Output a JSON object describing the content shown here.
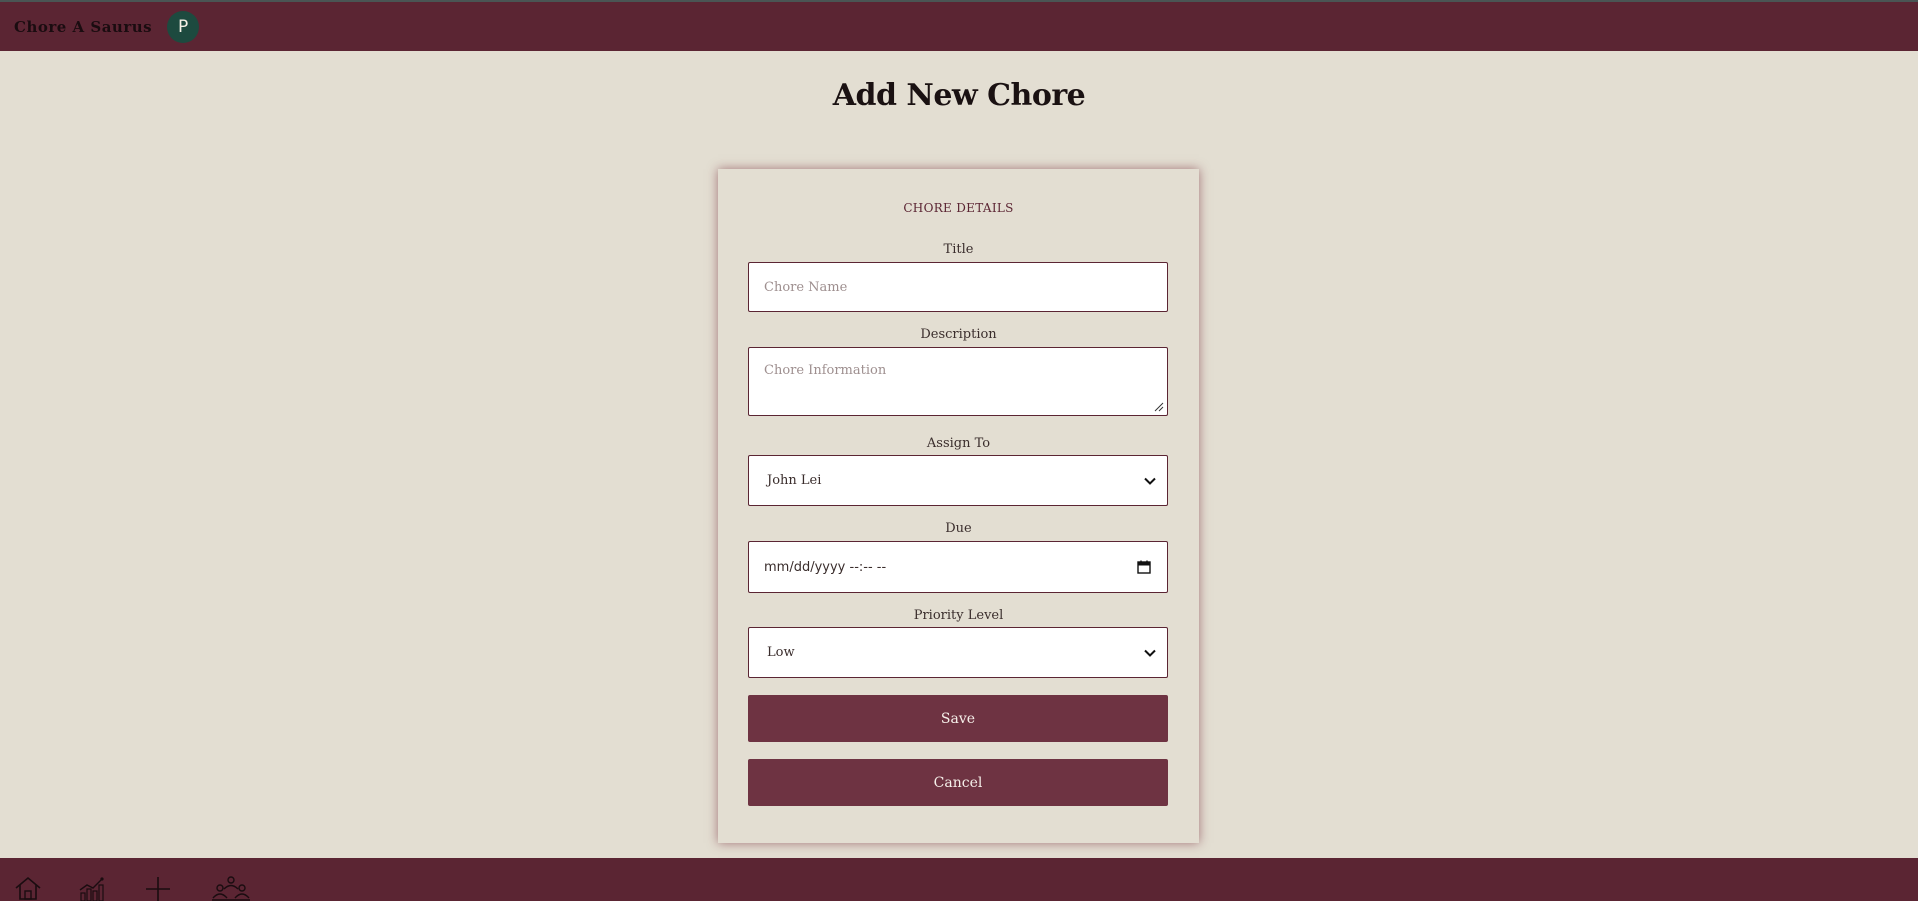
{
  "app": {
    "brand": "Chore A Saurus",
    "avatar_initial": "P"
  },
  "page": {
    "title": "Add New Chore"
  },
  "form": {
    "section_title": "CHORE DETAILS",
    "title_label": "Title",
    "title_placeholder": "Chore Name",
    "description_label": "Description",
    "description_placeholder": "Chore Information",
    "assign_label": "Assign To",
    "assign_value": "John Lei",
    "due_label": "Due",
    "due_placeholder": "mm/dd/yyyy --:-- --",
    "priority_label": "Priority Level",
    "priority_value": "Low",
    "save_label": "Save",
    "cancel_label": "Cancel"
  },
  "nav": {
    "icons": [
      "home-icon",
      "stats-icon",
      "add-icon",
      "family-icon"
    ]
  },
  "colors": {
    "accent": "#5b2533",
    "button": "#6e3342",
    "background": "#e3ded2",
    "avatar": "#1d4a3f"
  }
}
